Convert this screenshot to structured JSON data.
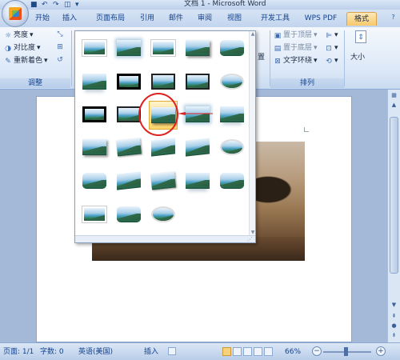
{
  "title_bar": {
    "title": "文档 1 - Microsoft Word",
    "qat_icons": [
      "save-icon",
      "undo-icon",
      "redo-icon",
      "print-preview-icon",
      "customize-icon"
    ]
  },
  "tabs": [
    {
      "label": "开始",
      "active": false
    },
    {
      "label": "插入",
      "active": false
    },
    {
      "label": "页面布局",
      "active": false
    },
    {
      "label": "引用",
      "active": false
    },
    {
      "label": "邮件",
      "active": false
    },
    {
      "label": "审阅",
      "active": false
    },
    {
      "label": "视图",
      "active": false
    },
    {
      "label": "开发工具",
      "active": false
    },
    {
      "label": "WPS PDF",
      "active": false
    },
    {
      "label": "格式",
      "active": true
    }
  ],
  "ribbon": {
    "adjust": {
      "label": "调整",
      "brightness": "亮度",
      "contrast": "对比度",
      "recolor": "重新着色"
    },
    "arrange": {
      "label": "排列",
      "bring_front": "置于顶层",
      "send_back": "置于底层",
      "text_wrap": "文字环绕",
      "position_partial": "置"
    },
    "size": {
      "label": "大小"
    }
  },
  "gallery": {
    "styles": [
      "simple-frame-white",
      "soft-edge-rectangle",
      "simple-frame-plain",
      "drop-shadow-rectangle",
      "rounded-rectangle",
      "reflected-rounded",
      "thick-matte-black",
      "simple-frame-black",
      "metal-frame",
      "oval-glow",
      "bevel-frame-black",
      "compound-frame-black",
      "center-shadow-rectangle",
      "soft-edge-oval",
      "reflected-bevel",
      "drop-shadow-white",
      "rotated-white",
      "perspective-shadow",
      "relaxed-perspective",
      "soft-edge-oval-2",
      "bevel-rectangle",
      "perspective-left",
      "perspective-right",
      "reflected-perspective",
      "metal-rounded",
      "snip-diagonal-white",
      "rounded-diagonal",
      "metal-oval"
    ],
    "selected_index": 12
  },
  "status_bar": {
    "page": "页面: 1/1",
    "words": "字数: 0",
    "language": "英语(美国)",
    "insert_mode": "插入",
    "zoom": "66%"
  },
  "colors": {
    "ribbon_text": "#15428b",
    "active_tab": "#f7c86a",
    "highlight_circle": "#e02020"
  }
}
